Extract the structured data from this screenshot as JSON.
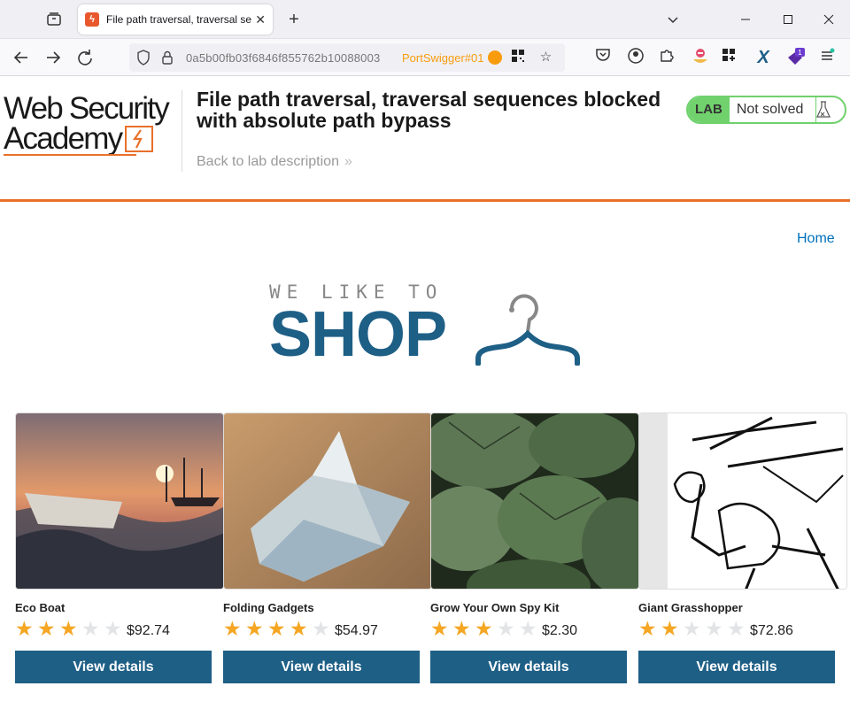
{
  "browser": {
    "tab_title": "File path traversal, traversal sequences blocked with absolute path bypass",
    "url": "0a5b00fb03f6846f855762b10088003",
    "container_label": "PortSwigger#01",
    "extension_badge": "1",
    "colors": {
      "container": "#f89c0e",
      "tab_favicon": "#e8582c"
    }
  },
  "lab": {
    "logo_line1": "Web Security",
    "logo_line2": "Academy",
    "title": "File path traversal, traversal sequences blocked with absolute path bypass",
    "back_link": "Back to lab description",
    "badge": "LAB",
    "status": "Not solved",
    "colors": {
      "accent": "#e8702a",
      "status_green": "#70d16d"
    }
  },
  "nav": {
    "home": "Home"
  },
  "shop_logo": {
    "tagline": "WE LIKE TO",
    "word": "SHOP",
    "color": "#1e5f86"
  },
  "products": [
    {
      "name": "Eco Boat",
      "rating": 3,
      "max_rating": 5,
      "price": "$92.74",
      "button": "View details"
    },
    {
      "name": "Folding Gadgets",
      "rating": 4,
      "max_rating": 5,
      "price": "$54.97",
      "button": "View details"
    },
    {
      "name": "Grow Your Own Spy Kit",
      "rating": 3,
      "max_rating": 5,
      "price": "$2.30",
      "button": "View details"
    },
    {
      "name": "Giant Grasshopper",
      "rating": 2,
      "max_rating": 5,
      "price": "$72.86",
      "button": "View details"
    }
  ]
}
